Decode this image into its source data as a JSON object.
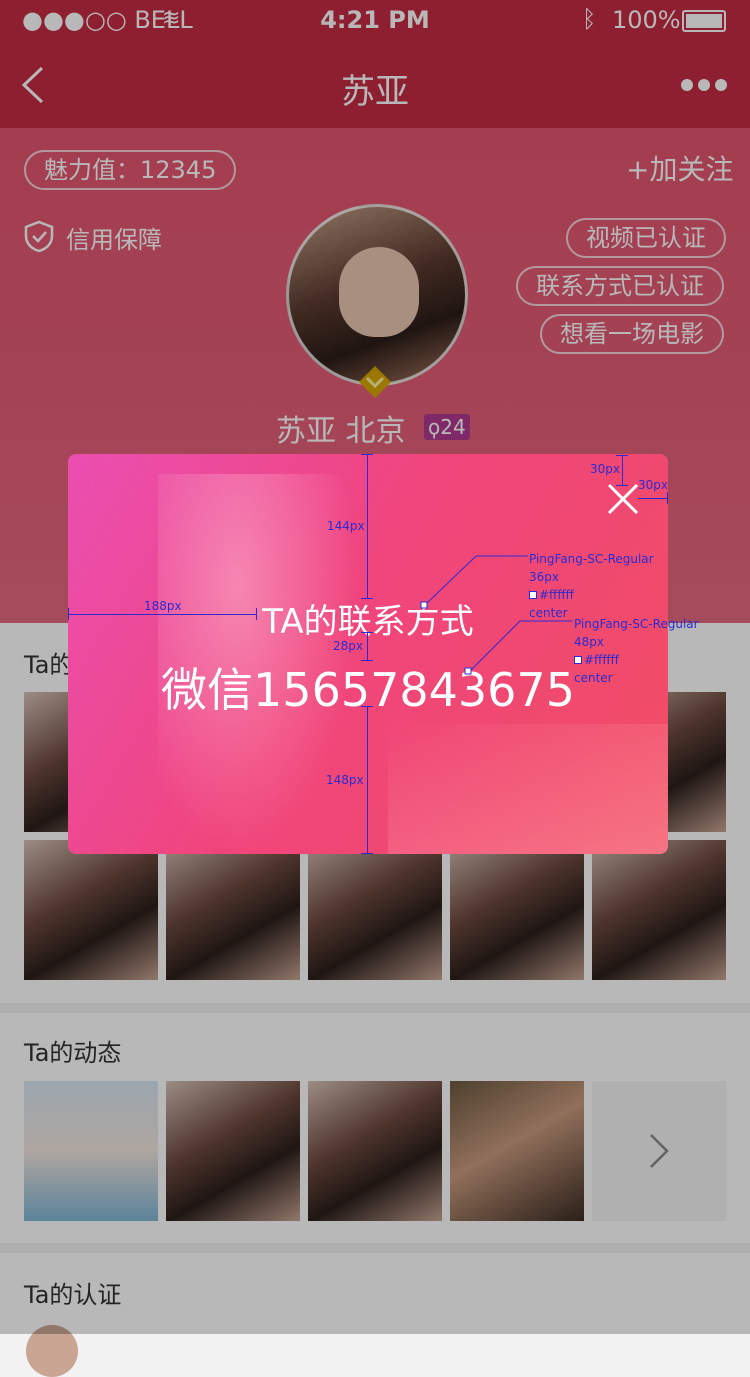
{
  "status_bar": {
    "carrier": "●●●○○ BELL",
    "time": "4:21 PM",
    "battery": "100%"
  },
  "nav": {
    "title": "苏亚",
    "back_icon": "chevron-left-icon",
    "more_icon": "more-dots-icon"
  },
  "profile": {
    "charm": "魅力值：12345",
    "follow": "+加关注",
    "credit": "信用保障",
    "badges": [
      "视频已认证",
      "联系方式已认证",
      "想看一场电影"
    ],
    "name_city": "苏亚 北京",
    "comment_count": "24"
  },
  "sections": {
    "photos_title": "Ta的相册",
    "moments_title": "Ta的动态",
    "auth_title": "Ta的认证"
  },
  "modal": {
    "heading": "TA的联系方式",
    "contact": "微信15657843675"
  },
  "annotations": {
    "top_gap": "30px",
    "right_gap": "30px",
    "heading_gap": "144px",
    "left_gap": "188px",
    "line_gap": "28px",
    "bottom_gap": "148px",
    "heading_spec": [
      "PingFang-SC-Regular",
      "36px",
      "#ffffff",
      "center"
    ],
    "contact_spec": [
      "PingFang-SC-Regular",
      "48px",
      "#ffffff",
      "center"
    ]
  },
  "colors": {
    "brand": "#c52b44",
    "modal_start": "#ea4fb1",
    "modal_end": "#f14d64",
    "spec": "#2b2bd1"
  }
}
